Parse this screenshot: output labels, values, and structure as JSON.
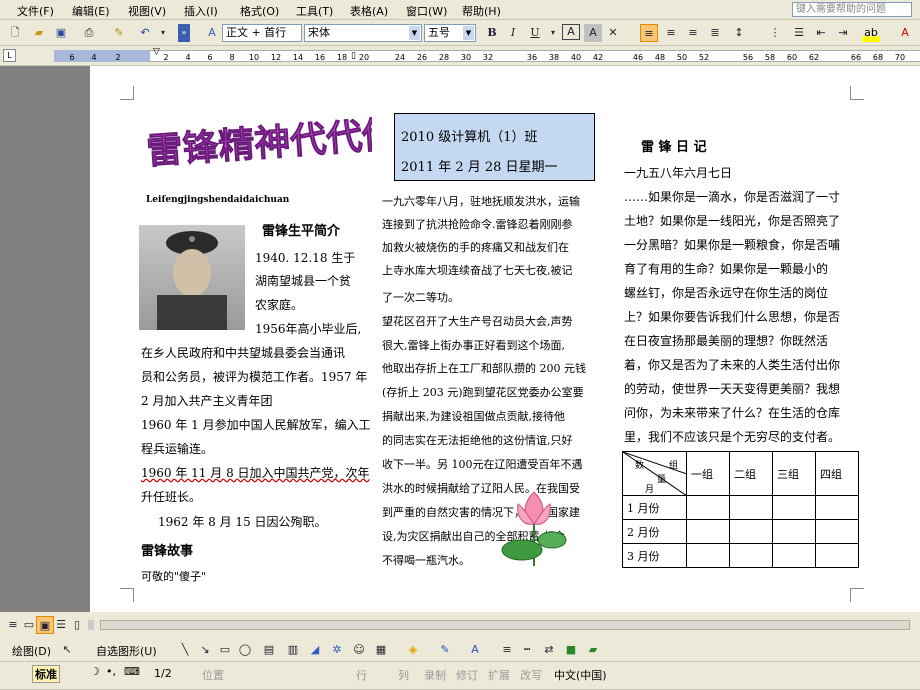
{
  "menubar": {
    "items": [
      "文件(F)",
      "编辑(E)",
      "视图(V)",
      "插入(I)",
      "格式(O)",
      "工具(T)",
      "表格(A)",
      "窗口(W)",
      "帮助(H)"
    ],
    "help_placeholder": "键入需要帮助的问题"
  },
  "toolbar": {
    "style": "正文 + 首行",
    "font": "宋体",
    "size": "五号",
    "bold": "B",
    "italic": "I",
    "underline": "U",
    "char_border": "A",
    "char_shade": "A"
  },
  "ruler": {
    "ticks": [
      "6",
      "4",
      "2",
      "2",
      "4",
      "6",
      "8",
      "10",
      "12",
      "14",
      "16",
      "18",
      "20",
      "24",
      "26",
      "28",
      "30",
      "32",
      "36",
      "38",
      "40",
      "42",
      "46",
      "48",
      "50",
      "52",
      "56",
      "58",
      "60",
      "62",
      "66",
      "68",
      "70",
      "72"
    ]
  },
  "document": {
    "title_art": "雷锋精神代代传",
    "pinyin": "Leifengjingshendaidaichuan",
    "bio_heading": "雷锋生平简介",
    "bio_lines": [
      "1940.    12.18 生于",
      "湖南望城县一个贫",
      "农家庭。",
      "1956年高小毕业后,",
      "在乡人民政府和中共望城县委会当通讯",
      "员和公务员，被评为模范工作者。1957 年",
      "2 月加入共产主义青年团",
      "1960 年 1 月参加中国人民解放军，编入工",
      "程兵运输连。",
      "1960 年 11 月 8 日加入中国共产党，次年",
      "升任班长。",
      "1962 年 8 月 15 日因公殉职。"
    ],
    "story_heading": "雷锋故事",
    "story_sub": "可敬的\"傻子\"",
    "class_box": [
      "2010 级计算机（1）班",
      "2011 年 2 月 28 日星期一"
    ],
    "middle_lines": [
      "一九六零年八月，驻地抚顺发洪水，运输",
      "连接到了抗洪抢险命令.雷锋忍着刚刚参",
      "加救火被烧伤的手的疼痛又和战友们在",
      "上寺水库大坝连续奋战了七天七夜,被记",
      "了一次二等功。",
      "望花区召开了大生产号召动员大会,声势",
      "很大,雷锋上街办事正好看到这个场面,",
      "他取出存折上在工厂和部队攒的 200 元钱",
      "(存折上 203 元)跑到望花区党委办公室要",
      "捐献出来,为建设祖国做点贡献,接待他",
      "的同志实在无法拒绝他的这份情谊,只好",
      "收下一半。另 100元在辽阳遭受百年不遇",
      "洪水的时候捐献给了辽阳人民。在我国受",
      "到严重的自然灾害的情况下，他为国家建",
      "设,为灾区捐献出自己的全部积蓄,却舍",
      "不得喝一瓶汽水。"
    ],
    "diary_heading": "雷 锋 日 记",
    "diary_lines": [
      "一九五八年六月七日",
      "……如果你是一滴水，你是否滋润了一寸",
      "土地？如果你是一线阳光，你是否照亮了",
      "一分黑暗？如果你是一颗粮食，你是否哺",
      "育了有用的生命？如果你是一颗最小的",
      "螺丝钉，你是否永远守在你生活的岗位",
      "上？如果你要告诉我们什么思想，你是否",
      "在日夜宣扬那最美丽的理想？你既然活",
      "着，你又是否为了未来的人类生活付出你",
      "的劳动，使世界一天天变得更美丽？我想",
      "问你，为未来带来了什么？在生活的仓库",
      "里，我们不应该只是个无穷尽的支付者。"
    ],
    "table": {
      "corner": {
        "top": "组",
        "mid": "量",
        "left": "数",
        "bottom": "月"
      },
      "columns": [
        "一组",
        "二组",
        "三组",
        "四组"
      ],
      "rows": [
        "1 月份",
        "2 月份",
        "3 月份"
      ]
    }
  },
  "drawbar": {
    "draw": "绘图(D)",
    "autoshape": "自选图形(U)"
  },
  "statusbar": {
    "ime": "标准",
    "page": "1/2",
    "position": "位置",
    "line": "行",
    "col": "列",
    "rec": "录制",
    "trk": "修订",
    "ext": "扩展",
    "ovr": "改写",
    "lang": "中文(中国)"
  },
  "colors": {
    "accent": "#ff9c00",
    "art": "#c040c0",
    "class_box": "#c4d8f2",
    "chrome": "#ece9d8"
  }
}
